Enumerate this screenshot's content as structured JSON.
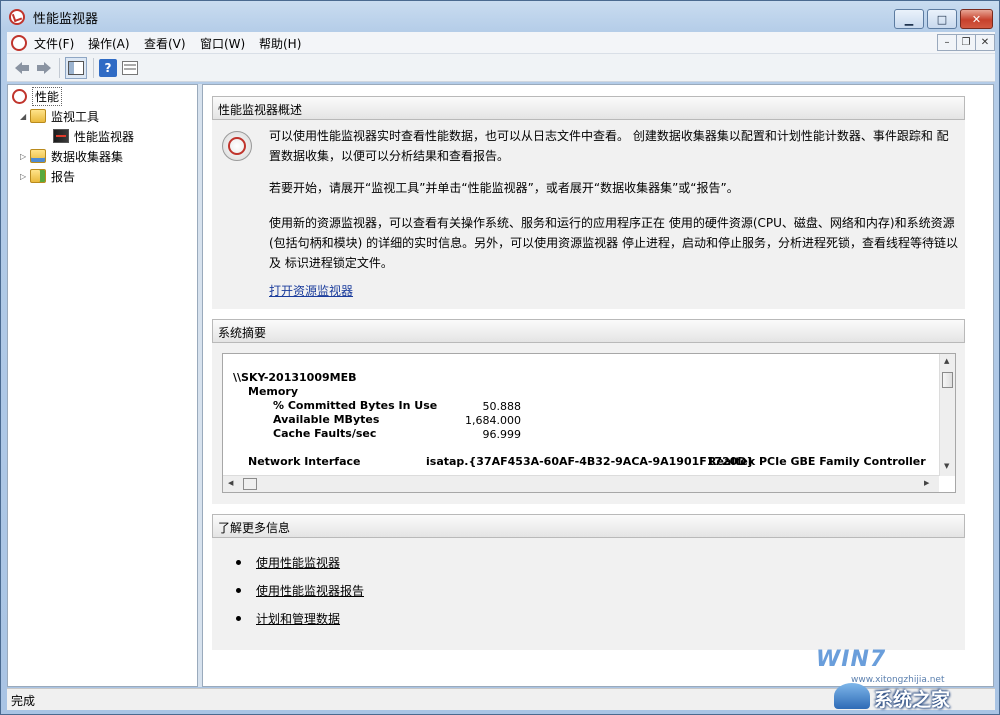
{
  "window": {
    "title": "性能监视器",
    "buttons": {
      "minimize": "▁",
      "maximize": "□",
      "close": "✕"
    }
  },
  "menubar": {
    "items": [
      "文件(F)",
      "操作(A)",
      "查看(V)",
      "窗口(W)",
      "帮助(H)"
    ],
    "mdi": {
      "minimize": "–",
      "restore": "❐",
      "close": "✕"
    }
  },
  "toolbar": {
    "back_icon": "back-arrow-icon",
    "forward_icon": "forward-arrow-icon",
    "show_tree_icon": "console-tree-icon",
    "help_label": "?",
    "properties_icon": "properties-icon"
  },
  "tree": {
    "root": "性能",
    "items": [
      {
        "label": "监视工具",
        "expanded": true
      },
      {
        "label": "性能监视器",
        "child": true
      },
      {
        "label": "数据收集器集",
        "expanded": false
      },
      {
        "label": "报告",
        "expanded": false
      }
    ]
  },
  "overview": {
    "heading": "性能监视器概述",
    "paragraphs": [
      "可以使用性能监视器实时查看性能数据，也可以从日志文件中查看。 创建数据收集器集以配置和计划性能计数器、事件跟踪和 配置数据收集，以便可以分析结果和查看报告。",
      "若要开始，请展开“监视工具”并单击“性能监视器”，或者展开“数据收集器集”或“报告”。",
      "使用新的资源监视器，可以查看有关操作系统、服务和运行的应用程序正在 使用的硬件资源(CPU、磁盘、网络和内存)和系统资源(包括句柄和模块) 的详细的实时信息。另外，可以使用资源监视器 停止进程，启动和停止服务，分析进程死锁，查看线程等待链以及 标识进程锁定文件。"
    ],
    "link": "打开资源监视器"
  },
  "summary": {
    "heading": "系统摘要",
    "computer": "\\\\SKY-20131009MEB",
    "memory_label": "Memory",
    "counters": [
      {
        "name": "% Committed Bytes In Use",
        "value": "50.888"
      },
      {
        "name": "Available MBytes",
        "value": "1,684.000"
      },
      {
        "name": "Cache Faults/sec",
        "value": "96.999"
      }
    ],
    "network_label": "Network Interface",
    "network_instances": [
      "isatap.{37AF453A-60AF-4B32-9ACA-9A1901F1720D}",
      "Realtek PCIe GBE Family Controller"
    ]
  },
  "more_info": {
    "heading": "了解更多信息",
    "links": [
      "使用性能监视器",
      "使用性能监视器报告",
      "计划和管理数据"
    ]
  },
  "statusbar": {
    "text": "完成"
  },
  "watermark": {
    "win": "WIN7",
    "url": "www.xitongzhijia.net",
    "brand": "系统之家"
  }
}
